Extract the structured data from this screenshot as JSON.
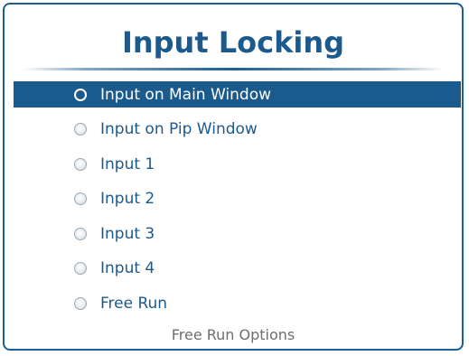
{
  "panel": {
    "title": "Input Locking",
    "options": [
      {
        "label": "Input on Main Window",
        "selected": true
      },
      {
        "label": "Input on Pip Window",
        "selected": false
      },
      {
        "label": "Input 1",
        "selected": false
      },
      {
        "label": "Input 2",
        "selected": false
      },
      {
        "label": "Input 3",
        "selected": false
      },
      {
        "label": "Input 4",
        "selected": false
      },
      {
        "label": "Free Run",
        "selected": false
      }
    ],
    "footer_link": "Free Run Options"
  },
  "colors": {
    "accent": "#1a5a8c",
    "title": "#1c5a8e",
    "muted_text": "#6e6e6e"
  }
}
